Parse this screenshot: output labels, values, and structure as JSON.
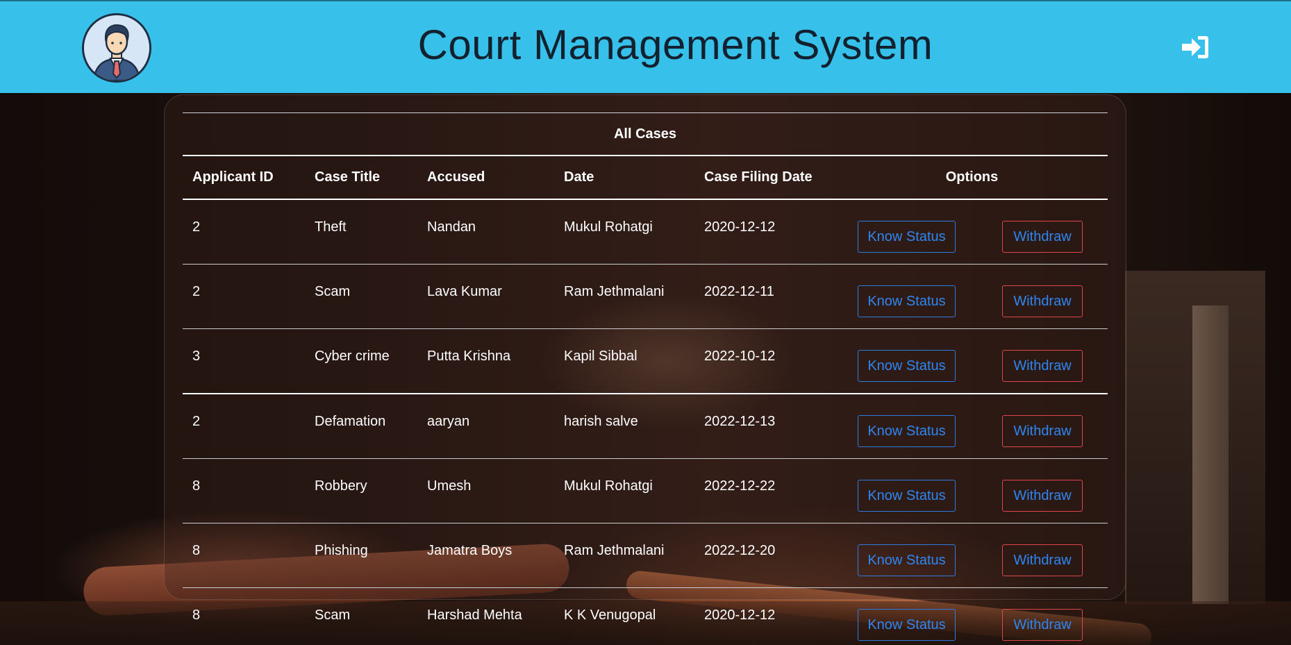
{
  "header": {
    "title": "Court Management System",
    "avatar_icon": "user-avatar-icon",
    "logout_icon": "sign-in-icon",
    "background_color": "#36c0ea"
  },
  "table": {
    "caption": "All Cases",
    "columns": [
      "Applicant ID",
      "Case Title",
      "Accused",
      "Date",
      "Case Filing Date",
      "Options"
    ],
    "rows": [
      {
        "applicant_id": "2",
        "case_title": "Theft",
        "accused": "Nandan",
        "date": "Mukul Rohatgi",
        "filing_date": "2020-12-12"
      },
      {
        "applicant_id": "2",
        "case_title": "Scam",
        "accused": "Lava Kumar",
        "date": "Ram Jethmalani",
        "filing_date": "2022-12-11"
      },
      {
        "applicant_id": "3",
        "case_title": "Cyber crime",
        "accused": "Putta Krishna",
        "date": "Kapil Sibbal",
        "filing_date": "2022-10-12"
      },
      {
        "applicant_id": "2",
        "case_title": "Defamation",
        "accused": "aaryan",
        "date": "harish salve",
        "filing_date": "2022-12-13"
      },
      {
        "applicant_id": "8",
        "case_title": "Robbery",
        "accused": "Umesh",
        "date": "Mukul Rohatgi",
        "filing_date": "2022-12-22"
      },
      {
        "applicant_id": "8",
        "case_title": "Phishing",
        "accused": "Jamatra Boys",
        "date": "Ram Jethmalani",
        "filing_date": "2022-12-20"
      },
      {
        "applicant_id": "8",
        "case_title": "Scam",
        "accused": "Harshad Mehta",
        "date": "K K Venugopal",
        "filing_date": "2020-12-12"
      }
    ],
    "buttons": {
      "know_status": "Know Status",
      "withdraw": "Withdraw"
    },
    "colors": {
      "know_status_border": "#2f7ce0",
      "withdraw_border": "#e0474a",
      "button_text": "#2f86f2"
    }
  }
}
